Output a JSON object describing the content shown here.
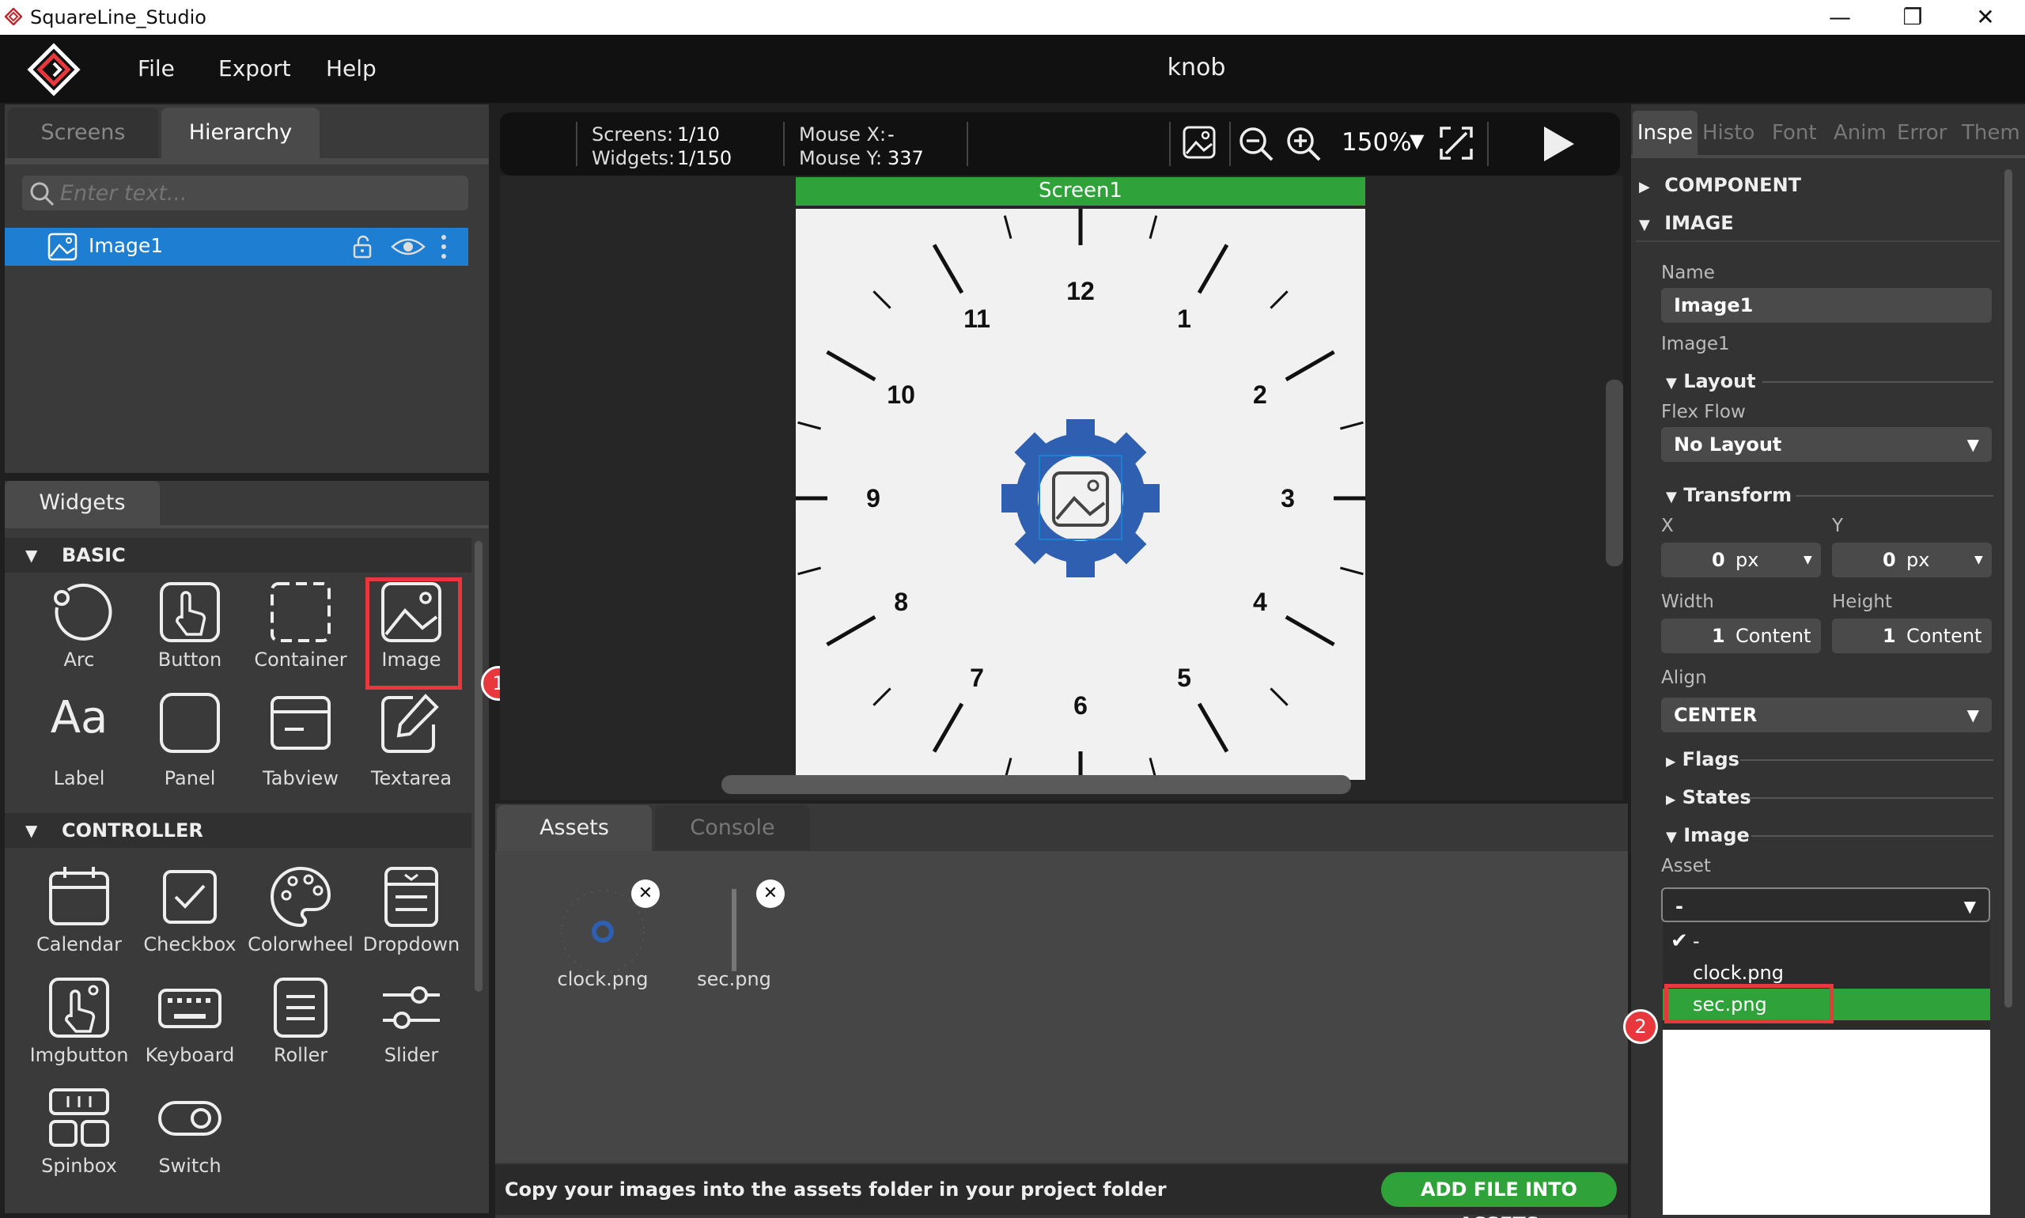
{
  "window": {
    "title": "SquareLine_Studio",
    "minimize": "—",
    "restore": "❐",
    "close": "✕"
  },
  "menu": {
    "file": "File",
    "export": "Export",
    "help": "Help"
  },
  "project": {
    "title": "knob"
  },
  "left": {
    "tabs": {
      "screens": "Screens",
      "hierarchy": "Hierarchy"
    },
    "search_placeholder": "Enter text...",
    "tree": [
      {
        "label": "Image1"
      }
    ]
  },
  "widgets": {
    "tab": "Widgets",
    "basic": {
      "title": "BASIC",
      "items": [
        "Arc",
        "Button",
        "Container",
        "Image",
        "Label",
        "Panel",
        "Tabview",
        "Textarea"
      ]
    },
    "controller": {
      "title": "CONTROLLER",
      "items": [
        "Calendar",
        "Checkbox",
        "Colorwheel",
        "Dropdown",
        "Imgbutton",
        "Keyboard",
        "Roller",
        "Slider",
        "Spinbox",
        "Switch"
      ]
    }
  },
  "toolbar": {
    "screens_label": "Screens:",
    "screens_value": "1/10",
    "widgets_label": "Widgets:",
    "widgets_value": "1/150",
    "mouse_x_label": "Mouse X:",
    "mouse_x_value": "-",
    "mouse_y_label": "Mouse Y:",
    "mouse_y_value": "337",
    "zoom": "150%"
  },
  "canvas": {
    "screen_name": "Screen1",
    "clock_numbers": [
      "12",
      "1",
      "2",
      "3",
      "4",
      "5",
      "6",
      "7",
      "8",
      "9",
      "10",
      "11"
    ]
  },
  "bottom": {
    "tabs": {
      "assets": "Assets",
      "console": "Console"
    },
    "assets": [
      {
        "name": "clock.png"
      },
      {
        "name": "sec.png"
      }
    ],
    "status_msg": "Copy your images into the assets folder in your project folder",
    "add_button": "ADD FILE INTO ASSETS"
  },
  "inspector": {
    "tabs": [
      "Inspe",
      "Histo",
      "Font",
      "Anim",
      "Error",
      "Them"
    ],
    "component": "COMPONENT",
    "image_section": "IMAGE",
    "name_label": "Name",
    "name_value": "Image1",
    "type_label": "Image1",
    "layout": {
      "title": "Layout",
      "flex_label": "Flex Flow",
      "flex_value": "No Layout"
    },
    "transform": {
      "title": "Transform",
      "x_label": "X",
      "x_value": "0",
      "x_unit": "px",
      "y_label": "Y",
      "y_value": "0",
      "y_unit": "px",
      "width_label": "Width",
      "width_value": "1",
      "width_unit": "Content",
      "height_label": "Height",
      "height_value": "1",
      "height_unit": "Content",
      "align_label": "Align",
      "align_value": "CENTER"
    },
    "flags": "Flags",
    "states": "States",
    "image": {
      "title": "Image",
      "asset_label": "Asset",
      "asset_value": "-",
      "options": [
        "-",
        "clock.png",
        "sec.png"
      ],
      "selected": "-",
      "highlighted": "sec.png"
    }
  },
  "annotations": {
    "step1": "1",
    "step2": "2"
  },
  "colors": {
    "accent_green": "#2fa339",
    "selection_blue": "#1e7ed1",
    "annotation_red": "#e8383d",
    "gear_blue": "#2f5fb0"
  }
}
